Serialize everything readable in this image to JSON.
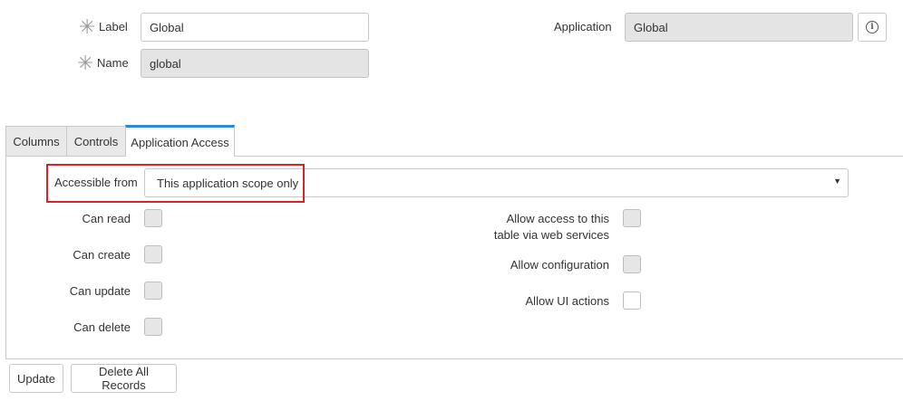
{
  "form": {
    "label_label": "Label",
    "label_value": "Global",
    "name_label": "Name",
    "name_value": "global",
    "application_label": "Application",
    "application_value": "Global"
  },
  "tabs": [
    {
      "label": "Columns"
    },
    {
      "label": "Controls"
    },
    {
      "label": "Application Access"
    }
  ],
  "access": {
    "accessible_from_label": "Accessible from",
    "accessible_from_value": "This application scope only",
    "left_checks": [
      {
        "label": "Can read"
      },
      {
        "label": "Can create"
      },
      {
        "label": "Can update"
      },
      {
        "label": "Can delete"
      }
    ],
    "right_checks": [
      {
        "label_line1": "Allow access to this",
        "label_line2": "table via web services"
      },
      {
        "label": "Allow configuration"
      },
      {
        "label": "Allow UI actions"
      }
    ]
  },
  "buttons": {
    "update": "Update",
    "delete_all": "Delete All Records"
  },
  "colors": {
    "accent_tab": "#2f8ad6",
    "highlight_red": "#d9232a",
    "readonly_bg": "#e4e4e4"
  }
}
